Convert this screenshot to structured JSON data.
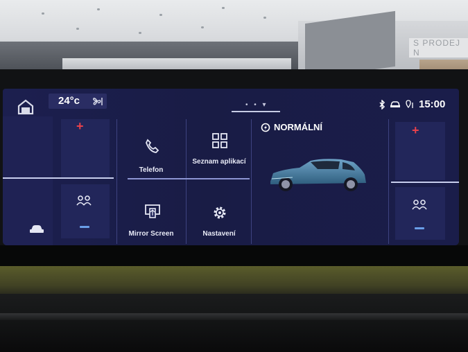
{
  "environment": {
    "sign_text": "S  PRODEJ N"
  },
  "topbar": {
    "home_icon": "home-icon",
    "temperature": "24°c",
    "fan_icon": "fan-icon",
    "pager_dots": "• • ▾",
    "status_icons": [
      "bluetooth-icon",
      "car-connect-icon",
      "location-icon"
    ],
    "time": "15:00"
  },
  "apps": [
    {
      "label": "Telefon",
      "icon": "phone-icon"
    },
    {
      "label": "Seznam aplikací",
      "icon": "app-grid-icon"
    },
    {
      "label": "Mirror Screen",
      "icon": "mirror-screen-icon"
    },
    {
      "label": "Nastavení",
      "icon": "settings-icon"
    }
  ],
  "drive_mode": {
    "icon": "drive-mode-icon",
    "label": "NORMÁLNÍ"
  },
  "left_climate": {
    "plus": "+",
    "seat_icon": "passengers-icon"
  },
  "right_climate": {
    "plus": "+",
    "seat_icon": "passengers-icon"
  },
  "vehicle_icon": "car-icon",
  "colors": {
    "screen_bg": "#1c1f4f",
    "tile_bg": "#22265a",
    "accent_red": "#e9414b",
    "accent_blue": "#6a9ee8"
  }
}
